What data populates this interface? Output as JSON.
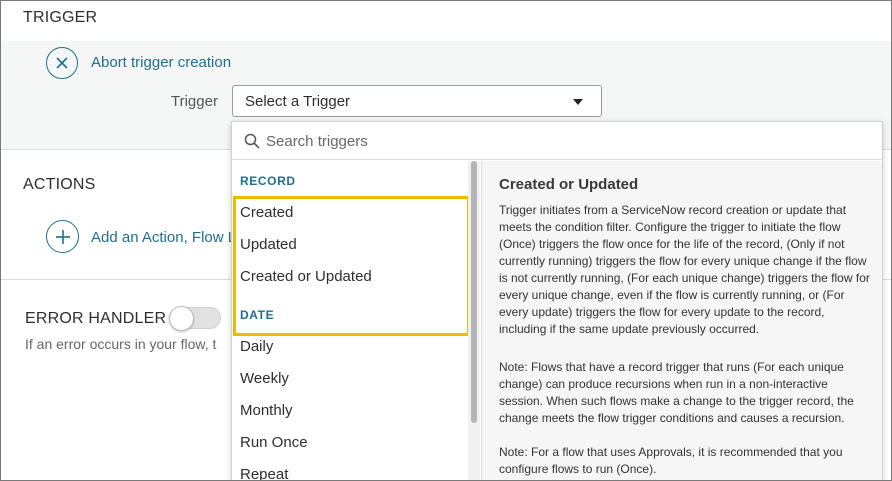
{
  "trigger_section": {
    "title": "TRIGGER",
    "abort_label": "Abort trigger creation",
    "field_label": "Trigger",
    "select_value": "Select a Trigger"
  },
  "actions_section": {
    "title": "ACTIONS",
    "add_label": "Add an Action, Flow L"
  },
  "error_section": {
    "title": "ERROR HANDLER",
    "toggle_on": false,
    "description": "If an error occurs in your flow, t"
  },
  "dropdown": {
    "search_placeholder": "Search triggers",
    "groups": [
      {
        "header": "RECORD",
        "items": [
          "Created",
          "Updated",
          "Created or Updated"
        ]
      },
      {
        "header": "DATE",
        "items": [
          "Daily",
          "Weekly",
          "Monthly",
          "Run Once",
          "Repeat"
        ]
      }
    ],
    "highlight_color": "#f3b800",
    "detail": {
      "title": "Created or Updated",
      "paragraphs": [
        "Trigger initiates from a ServiceNow record creation or update that meets the condition filter. Configure the trigger to initiate the flow (Once) triggers the flow once for the life of the record, (Only if not currently running) triggers the flow for every unique change if the flow is not currently running, (For each unique change) triggers the flow for every unique change, even if the flow is currently running, or (For every update) triggers the flow for every update to the record, including if the same update previously occurred.",
        "Note: Flows that have a record trigger that runs (For each unique change) can produce recursions when run in a non-interactive session. When such flows make a change to the trigger record, the change meets the flow trigger conditions and causes a recursion.",
        "Note: For a flow that uses Approvals, it is recommended that you configure flows to run (Once)."
      ]
    }
  },
  "colors": {
    "accent": "#1f6f8b",
    "group_header": "#1f6f8b"
  }
}
